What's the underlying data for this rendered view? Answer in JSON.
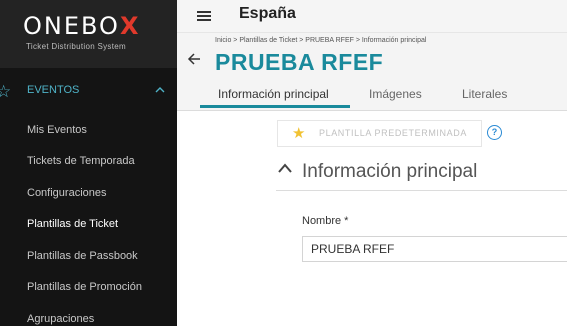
{
  "sidebar": {
    "logo": {
      "text": "ONEBO",
      "x": "X",
      "subtitle": "Ticket Distribution System"
    },
    "section": {
      "icon": "star-outline-icon",
      "label": "EVENTOS",
      "chevron": "chevron-up-icon",
      "color": "#4fb3c8"
    },
    "items": [
      {
        "label": "Mis Eventos"
      },
      {
        "label": "Tickets de Temporada"
      },
      {
        "label": "Configuraciones"
      },
      {
        "label": "Plantillas de Ticket"
      },
      {
        "label": "Plantillas de Passbook"
      },
      {
        "label": "Plantillas de Promoción"
      },
      {
        "label": "Agrupaciones"
      }
    ]
  },
  "topbar": {
    "menu_icon": "hamburger-icon",
    "title": "España"
  },
  "header": {
    "breadcrumb": "Inicio > Plantillas de Ticket > PRUEBA RFEF > Información principal",
    "back_icon": "arrow-left-icon",
    "title": "PRUEBA RFEF",
    "tabs": [
      {
        "label": "Información principal",
        "active": true
      },
      {
        "label": "Imágenes",
        "active": false
      },
      {
        "label": "Literales",
        "active": false
      }
    ],
    "accent": "#1a8a9c"
  },
  "main": {
    "template_button": {
      "icon": "star-icon",
      "label": "PLANTILLA PREDETERMINADA"
    },
    "help_icon": "help-circle-icon",
    "help_glyph": "?",
    "section": {
      "chevron": "chevron-up-icon",
      "title": "Información principal"
    },
    "name_field": {
      "label": "Nombre *",
      "value": "PRUEBA RFEF"
    }
  }
}
